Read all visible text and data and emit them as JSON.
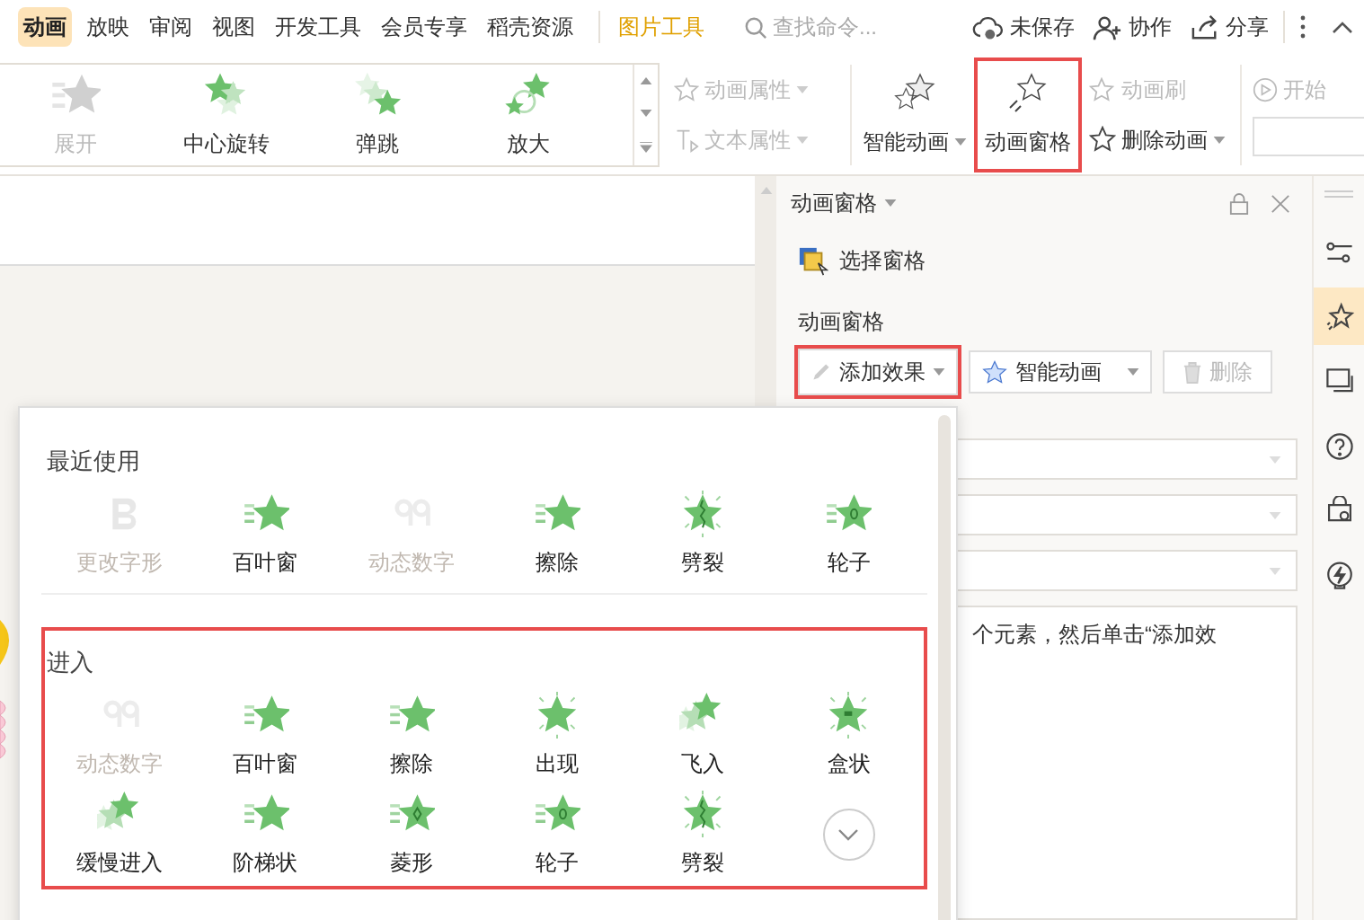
{
  "menu_tabs": [
    {
      "label": "动画",
      "selected": true
    },
    {
      "label": "放映",
      "selected": false
    },
    {
      "label": "审阅",
      "selected": false
    },
    {
      "label": "视图",
      "selected": false
    },
    {
      "label": "开发工具",
      "selected": false
    },
    {
      "label": "会员专享",
      "selected": false
    },
    {
      "label": "稻壳资源",
      "selected": false
    }
  ],
  "context_tab": "图片工具",
  "search": {
    "placeholder": "查找命令..."
  },
  "top_actions": [
    {
      "kind": "unsaved",
      "label": "未保存"
    },
    {
      "kind": "collab",
      "label": "协作"
    },
    {
      "kind": "share",
      "label": "分享"
    }
  ],
  "ribbon": {
    "gallery": [
      {
        "label": "展开",
        "disabled": true,
        "kind": "expand"
      },
      {
        "label": "中心旋转",
        "disabled": false,
        "kind": "spin"
      },
      {
        "label": "弹跳",
        "disabled": false,
        "kind": "bounce"
      },
      {
        "label": "放大",
        "disabled": false,
        "kind": "zoom"
      }
    ],
    "properties": [
      {
        "label": "动画属性",
        "disabled": true
      },
      {
        "label": "文本属性",
        "disabled": true
      }
    ],
    "smart_animation": {
      "label": "智能动画"
    },
    "animation_pane": {
      "label": "动画窗格",
      "highlighted": true
    },
    "animation_brush": {
      "label": "动画刷",
      "disabled": true
    },
    "delete_animation": {
      "label": "删除动画"
    },
    "start": {
      "label": "开始",
      "disabled": true
    }
  },
  "pane": {
    "title": "动画窗格",
    "select_pane": "选择窗格",
    "section": "动画窗格",
    "add_effect": {
      "label": "添加效果",
      "highlighted": true
    },
    "smart_animation": {
      "label": "智能动画"
    },
    "delete": {
      "label": "删除",
      "disabled": true
    },
    "hint": "个元素，然后单击“添加效"
  },
  "side_tools": [
    {
      "kind": "sliders",
      "selected": false
    },
    {
      "kind": "star",
      "selected": true
    },
    {
      "kind": "screen",
      "selected": false
    },
    {
      "kind": "help",
      "selected": false
    },
    {
      "kind": "bag",
      "selected": false
    },
    {
      "kind": "bolt",
      "selected": false
    }
  ],
  "effects_menu": {
    "sections": [
      {
        "title": "最近使用",
        "highlighted": false,
        "items": [
          {
            "label": "更改字形",
            "disabled": true,
            "kind": "letter"
          },
          {
            "label": "百叶窗",
            "disabled": false,
            "kind": "stripes"
          },
          {
            "label": "动态数字",
            "disabled": true,
            "kind": "digits"
          },
          {
            "label": "擦除",
            "disabled": false,
            "kind": "stripes"
          },
          {
            "label": "劈裂",
            "disabled": false,
            "kind": "split"
          },
          {
            "label": "轮子",
            "disabled": false,
            "kind": "wheel"
          }
        ]
      },
      {
        "title": "进入",
        "highlighted": true,
        "more": true,
        "items": [
          {
            "label": "动态数字",
            "disabled": true,
            "kind": "digits"
          },
          {
            "label": "百叶窗",
            "disabled": false,
            "kind": "stripes"
          },
          {
            "label": "擦除",
            "disabled": false,
            "kind": "stripes"
          },
          {
            "label": "出现",
            "disabled": false,
            "kind": "burst"
          },
          {
            "label": "飞入",
            "disabled": false,
            "kind": "fly"
          },
          {
            "label": "盒状",
            "disabled": false,
            "kind": "box"
          },
          {
            "label": "缓慢进入",
            "disabled": false,
            "kind": "fly"
          },
          {
            "label": "阶梯状",
            "disabled": false,
            "kind": "stripes"
          },
          {
            "label": "菱形",
            "disabled": false,
            "kind": "diamond"
          },
          {
            "label": "轮子",
            "disabled": false,
            "kind": "wheel"
          },
          {
            "label": "劈裂",
            "disabled": false,
            "kind": "split"
          }
        ]
      }
    ]
  }
}
